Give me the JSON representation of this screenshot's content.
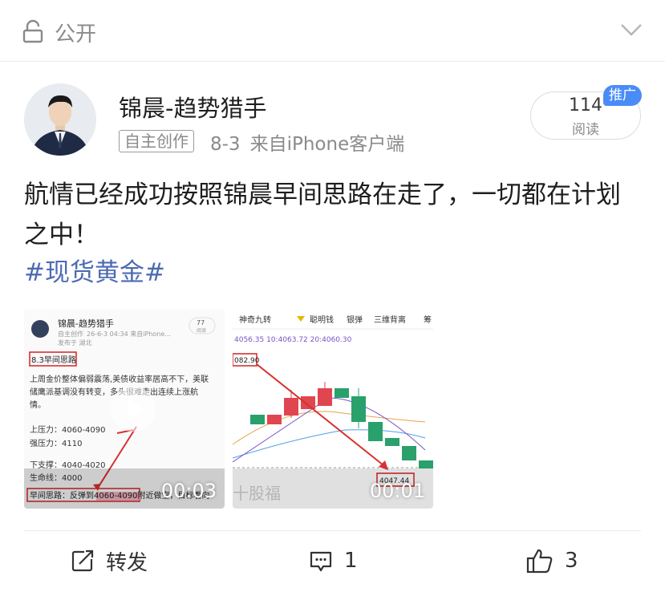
{
  "header": {
    "visibility_label": "公开",
    "lock_icon": "lock-icon",
    "collapse_icon": "chevron-down-icon"
  },
  "post": {
    "author": "锦晨-趋势猎手",
    "badge": "自主创作",
    "date": "8-3",
    "source": "来自iPhone客户端",
    "reads": "114",
    "reads_label": "阅读",
    "promo_tag": "推广",
    "text": "航情已经成功按照锦晨早间思路在走了，一切都在计划之中！",
    "topic": "#现货黄金#"
  },
  "media": [
    {
      "duration": "00:03",
      "mini_author": "锦晨-趋势猎手",
      "mini_badge": "自主创作",
      "mini_meta": "26-6-3 04:34 来自iPhone...",
      "mini_loc": "发布于 湖北",
      "mini_reads": "77",
      "mini_reads_label": "阅读",
      "title_box": "8.3早间思路",
      "para": "上周金价整体偏弱震荡,美债收益率居高不下，美联储鹰派基调没有转变，多头很难走出连续上涨航情。",
      "lines": [
        "上压力：4060-4090",
        "强压力：4110",
        "下支撑：4040-4020",
        "生命线：4000"
      ],
      "plan": "早间思路：反弹到4060-4090附近做空，目标看向"
    },
    {
      "duration": "00:01",
      "toolbar": [
        "神奇九转",
        "聪明钱",
        "银弹",
        "三维背离",
        "筹"
      ],
      "legend": "4056.35  10:4063.72  20:4060.30",
      "price_box_top": "082.90",
      "price_box_bottom": "4047.44",
      "watermark": "十股福"
    }
  ],
  "actions": {
    "repost_label": "转发",
    "comment_count": "1",
    "like_count": "3"
  },
  "colors": {
    "topic": "#4d6bb3",
    "promo": "#4a8cf7",
    "bull": "#e0464f",
    "bear": "#2aa06d"
  }
}
